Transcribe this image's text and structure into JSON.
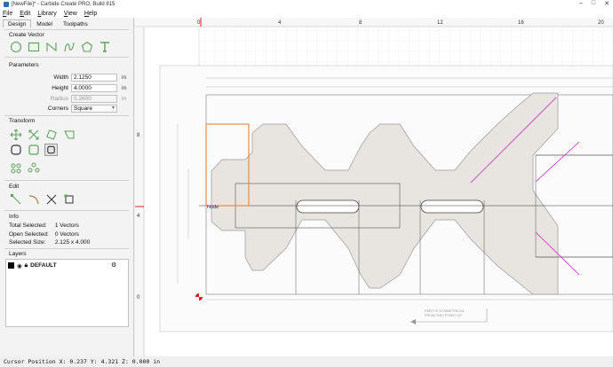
{
  "window": {
    "title": "[NewFile]* - Carbide Create PRO, Build 815"
  },
  "menu": [
    "File",
    "Edit",
    "Library",
    "View",
    "Help"
  ],
  "tabs": [
    "Design",
    "Model",
    "Toolpaths"
  ],
  "create_vector": {
    "title": "Create Vector"
  },
  "parameters": {
    "title": "Parameters",
    "width_label": "Width",
    "width_value": "2.1250",
    "width_unit": "in",
    "height_label": "Height",
    "height_value": "4.0000",
    "height_unit": "in",
    "radius_label": "Radius",
    "radius_value": "0.2600",
    "radius_unit": "in",
    "corners_label": "Corners",
    "corners_value": "Square"
  },
  "transform": {
    "title": "Transform"
  },
  "edit": {
    "title": "Edit"
  },
  "info": {
    "title": "Info",
    "total_selected_label": "Total Selected:",
    "total_selected_value": "1 Vectors",
    "open_selected_label": "Open Selected:",
    "open_selected_value": "0 Vectors",
    "selected_size_label": "Selected Size:",
    "selected_size_value": "2.125 x 4.000"
  },
  "layers": {
    "title": "Layers",
    "items": [
      {
        "name": "DEFAULT",
        "color": "#000000"
      }
    ]
  },
  "ruler": {
    "top_ticks": [
      "0",
      "4",
      "8",
      "12",
      "16",
      "20"
    ],
    "left_ticks": [
      "8",
      "4",
      "0"
    ]
  },
  "canvas": {
    "node_label": "Node",
    "drawing_note_line1": "PART IS SYMMETRICAL",
    "drawing_note_line2": "FROM THIS POINT UP"
  },
  "status": {
    "cursor": "Cursor Position X: 0.237 Y: 4.321 Z: 0.000 in"
  },
  "colors": {
    "accent": "#5aa05a",
    "selection": "#e07a2a",
    "guide": "#d020d0",
    "shape_fill": "#e8e4df"
  }
}
